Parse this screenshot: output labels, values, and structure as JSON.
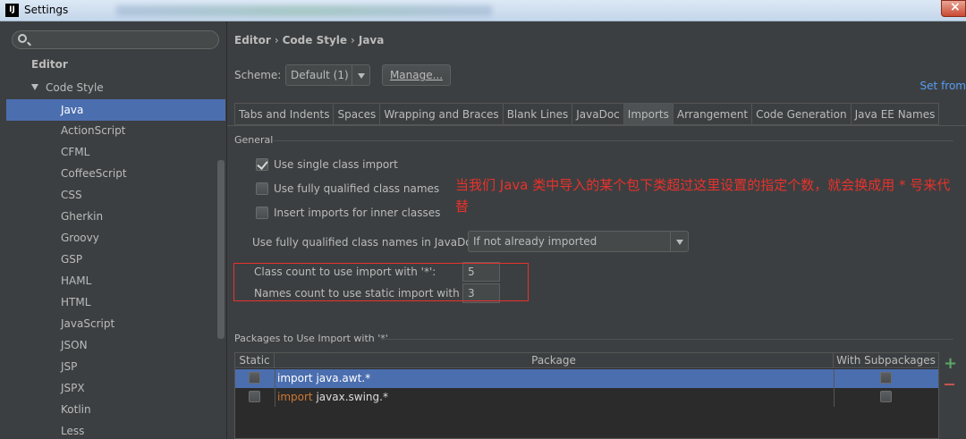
{
  "window": {
    "title": "Settings",
    "logo": "IJ"
  },
  "sidebar": {
    "search_placeholder": "",
    "items": [
      {
        "label": "Editor",
        "level": 0
      },
      {
        "label": "Code Style",
        "level": 1,
        "expanded": true
      },
      {
        "label": "Java",
        "level": 2,
        "selected": true
      },
      {
        "label": "ActionScript",
        "level": 2
      },
      {
        "label": "CFML",
        "level": 2
      },
      {
        "label": "CoffeeScript",
        "level": 2
      },
      {
        "label": "CSS",
        "level": 2
      },
      {
        "label": "Gherkin",
        "level": 2
      },
      {
        "label": "Groovy",
        "level": 2
      },
      {
        "label": "GSP",
        "level": 2
      },
      {
        "label": "HAML",
        "level": 2
      },
      {
        "label": "HTML",
        "level": 2
      },
      {
        "label": "JavaScript",
        "level": 2
      },
      {
        "label": "JSON",
        "level": 2
      },
      {
        "label": "JSP",
        "level": 2
      },
      {
        "label": "JSPX",
        "level": 2
      },
      {
        "label": "Kotlin",
        "level": 2
      },
      {
        "label": "Less",
        "level": 2
      }
    ]
  },
  "breadcrumb": {
    "parts": [
      "Editor",
      "Code Style",
      "Java"
    ],
    "sep": "›"
  },
  "scheme": {
    "label": "Scheme:",
    "value": "Default (1)",
    "manage": "Manage...",
    "set_from": "Set from"
  },
  "tabs": [
    {
      "label": "Tabs and Indents"
    },
    {
      "label": "Spaces"
    },
    {
      "label": "Wrapping and Braces"
    },
    {
      "label": "Blank Lines"
    },
    {
      "label": "JavaDoc"
    },
    {
      "label": "Imports",
      "active": true
    },
    {
      "label": "Arrangement"
    },
    {
      "label": "Code Generation"
    },
    {
      "label": "Java EE Names"
    }
  ],
  "general": {
    "title": "General",
    "options": [
      {
        "label": "Use single class import",
        "checked": true
      },
      {
        "label": "Use fully qualified class names",
        "checked": false
      },
      {
        "label": "Insert imports for inner classes",
        "checked": false
      }
    ],
    "javadoc_label": "Use fully qualified class names in JavaDoc:",
    "javadoc_value": "If not already imported",
    "class_count_label": "Class count to use import with '*':",
    "class_count_value": "5",
    "names_count_label": "Names count to use static import with '*':",
    "names_count_value": "3"
  },
  "annotation": "当我们 Java 类中导入的某个包下类超过这里设置的指定个数，就会换成用 * 号来代替",
  "packages": {
    "title": "Packages to Use Import with '*'",
    "columns": [
      "Static",
      "Package",
      "With Subpackages"
    ],
    "rows": [
      {
        "keyword": "import",
        "name": "java.awt.*",
        "selected": true
      },
      {
        "keyword": "import",
        "name": "javax.swing.*",
        "selected": false
      }
    ]
  },
  "colors": {
    "accent": "#4b6eaf",
    "annotation": "#e8322c",
    "link": "#589df6",
    "keyword": "#cc7832"
  },
  "icons": {
    "search": "search-icon",
    "add": "plus-icon",
    "remove": "minus-icon"
  }
}
